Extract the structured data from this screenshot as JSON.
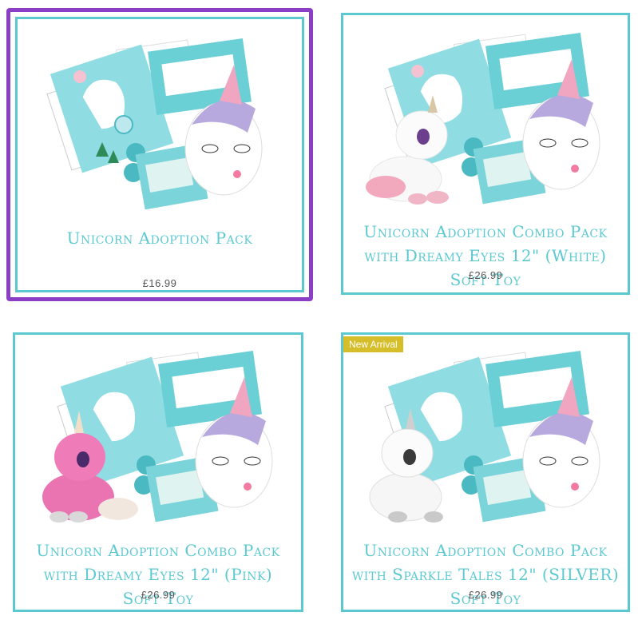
{
  "products": [
    {
      "title": "Unicorn Adoption Pack",
      "price": "£16.99",
      "badge": "",
      "toy": "none",
      "selected": true
    },
    {
      "title": "Unicorn Adoption Combo Pack with Dreamy Eyes 12\" (White) Soft Toy",
      "price": "£26.99",
      "badge": "",
      "toy": "white-unicorn",
      "selected": false
    },
    {
      "title": "Unicorn Adoption Combo Pack with Dreamy Eyes 12\" (Pink) Soft Toy",
      "price": "£26.99",
      "badge": "",
      "toy": "pink-unicorn",
      "selected": false
    },
    {
      "title": "Unicorn Adoption Combo Pack with Sparkle Tales 12\" (SILVER) Soft Toy",
      "price": "£26.99",
      "badge": "New Arrival",
      "toy": "silver-unicorn",
      "selected": false
    }
  ],
  "colors": {
    "accent": "#5cc9d1",
    "selected_outline": "#8a3fc6",
    "badge": "#d6bd2a",
    "price_text": "#555555"
  }
}
